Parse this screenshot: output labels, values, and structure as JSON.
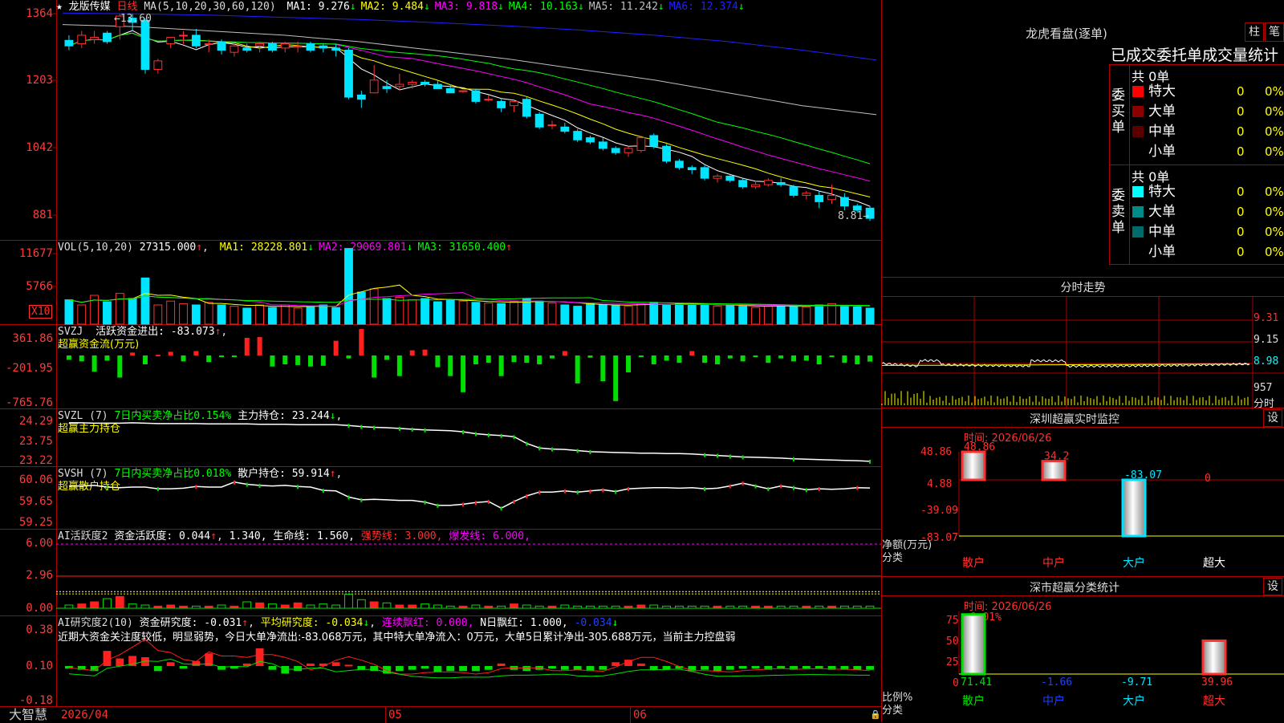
{
  "app": {
    "brand": "大智慧"
  },
  "main": {
    "stock_name": "龙版传媒",
    "period": "日线",
    "ma_params": "MA(5,10,20,30,60,120)",
    "ma": [
      {
        "label": "MA1:",
        "value": "9.276",
        "arrow": "↓",
        "color": "#ffffff"
      },
      {
        "label": "MA2:",
        "value": "9.484",
        "arrow": "↓",
        "color": "#ffff00"
      },
      {
        "label": "MA3:",
        "value": "9.818",
        "arrow": "↓",
        "color": "#ff00ff"
      },
      {
        "label": "MA4:",
        "value": "10.163",
        "arrow": "↓",
        "color": "#00ff00"
      },
      {
        "label": "MA5:",
        "value": "11.242",
        "arrow": "↓",
        "color": "#c0c0c0"
      },
      {
        "label": "MA6:",
        "value": "12.374",
        "arrow": "↓",
        "color": "#2020ff"
      }
    ],
    "y_labels": [
      "1364",
      "1203",
      "1042",
      "881"
    ],
    "high_marker": "←13.60",
    "low_marker": "8.81→",
    "candles": [
      [
        12.98,
        13.1,
        12.75,
        12.85
      ],
      [
        12.9,
        13.2,
        12.8,
        13.1
      ],
      [
        13.0,
        13.2,
        12.9,
        13.05
      ],
      [
        13.15,
        13.2,
        12.9,
        12.95
      ],
      [
        13.3,
        13.6,
        13.0,
        13.55
      ],
      [
        13.5,
        13.6,
        13.2,
        13.4
      ],
      [
        13.45,
        13.5,
        12.2,
        12.3
      ],
      [
        12.3,
        12.55,
        12.2,
        12.5
      ],
      [
        12.9,
        13.05,
        12.8,
        13.05
      ],
      [
        13.1,
        13.2,
        12.9,
        13.1
      ],
      [
        13.1,
        13.25,
        12.8,
        12.85
      ],
      [
        12.9,
        13.0,
        12.7,
        12.9
      ],
      [
        12.95,
        13.0,
        12.65,
        12.75
      ],
      [
        12.7,
        12.9,
        12.6,
        12.85
      ],
      [
        12.8,
        12.9,
        12.7,
        12.75
      ],
      [
        12.85,
        12.95,
        12.7,
        12.9
      ],
      [
        12.9,
        12.95,
        12.7,
        12.75
      ],
      [
        12.8,
        12.95,
        12.7,
        12.9
      ],
      [
        12.85,
        12.95,
        12.7,
        12.85
      ],
      [
        12.9,
        12.95,
        12.7,
        12.75
      ],
      [
        12.85,
        12.9,
        12.7,
        12.8
      ],
      [
        12.8,
        12.9,
        12.6,
        12.75
      ],
      [
        12.75,
        12.8,
        11.6,
        11.65
      ],
      [
        11.7,
        11.8,
        11.4,
        11.6
      ],
      [
        11.75,
        12.4,
        11.8,
        12.05
      ],
      [
        11.9,
        12.05,
        11.75,
        11.85
      ],
      [
        11.9,
        12.2,
        11.8,
        11.95
      ],
      [
        11.95,
        12.05,
        11.85,
        12.0
      ],
      [
        12.0,
        12.05,
        11.9,
        11.95
      ],
      [
        11.95,
        12.05,
        11.85,
        11.85
      ],
      [
        11.85,
        11.95,
        11.75,
        11.75
      ],
      [
        11.8,
        11.8,
        11.75,
        11.8
      ],
      [
        11.8,
        11.85,
        11.5,
        11.55
      ],
      [
        11.6,
        11.7,
        11.55,
        11.6
      ],
      [
        11.55,
        11.6,
        11.3,
        11.4
      ],
      [
        11.45,
        11.55,
        11.3,
        11.55
      ],
      [
        11.6,
        11.65,
        11.15,
        11.2
      ],
      [
        11.25,
        11.3,
        10.9,
        10.95
      ],
      [
        11.0,
        11.1,
        10.9,
        11.0
      ],
      [
        10.95,
        11.05,
        10.8,
        10.85
      ],
      [
        10.85,
        10.9,
        10.6,
        10.65
      ],
      [
        10.7,
        10.75,
        10.55,
        10.6
      ],
      [
        10.6,
        10.7,
        10.4,
        10.45
      ],
      [
        10.45,
        10.5,
        10.3,
        10.35
      ],
      [
        10.35,
        10.5,
        10.25,
        10.45
      ],
      [
        10.4,
        10.75,
        10.35,
        10.7
      ],
      [
        10.75,
        10.8,
        10.45,
        10.5
      ],
      [
        10.5,
        10.55,
        10.1,
        10.15
      ],
      [
        10.15,
        10.2,
        9.95,
        10.0
      ],
      [
        10.0,
        10.05,
        9.85,
        9.95
      ],
      [
        10.0,
        10.05,
        9.7,
        9.75
      ],
      [
        9.75,
        9.85,
        9.65,
        9.8
      ],
      [
        9.8,
        9.85,
        9.65,
        9.7
      ],
      [
        9.7,
        9.75,
        9.5,
        9.55
      ],
      [
        9.55,
        9.7,
        9.5,
        9.6
      ],
      [
        9.6,
        9.75,
        9.55,
        9.7
      ],
      [
        9.65,
        9.75,
        9.55,
        9.6
      ],
      [
        9.55,
        9.6,
        9.3,
        9.35
      ],
      [
        9.35,
        9.45,
        9.25,
        9.4
      ],
      [
        9.35,
        9.45,
        9.05,
        9.2
      ],
      [
        9.25,
        9.6,
        9.15,
        9.35
      ],
      [
        9.3,
        9.4,
        9.0,
        9.1
      ],
      [
        9.1,
        9.15,
        8.95,
        9.0
      ],
      [
        9.05,
        9.1,
        8.75,
        8.81
      ]
    ]
  },
  "vol": {
    "params": "VOL(5,10,20)",
    "value": "27315.000",
    "value_arrow": "↑",
    "ma": [
      {
        "label": "MA1:",
        "value": "28228.801",
        "arrow": "↓",
        "color": "#ffff00"
      },
      {
        "label": "MA2:",
        "value": "29069.801",
        "arrow": "↓",
        "color": "#ff00ff"
      },
      {
        "label": "MA3:",
        "value": "31650.400",
        "arrow": "↑",
        "color": "#00ff00"
      }
    ],
    "y_labels": [
      "11677",
      "5766"
    ],
    "unit": "X10",
    "bars": [
      38,
      30,
      45,
      35,
      48,
      40,
      72,
      30,
      36,
      32,
      30,
      34,
      30,
      28,
      25,
      30,
      26,
      30,
      25,
      28,
      30,
      26,
      118,
      50,
      55,
      40,
      42,
      38,
      40,
      35,
      38,
      36,
      34,
      33,
      32,
      35,
      40,
      36,
      33,
      30,
      28,
      32,
      30,
      30,
      28,
      32,
      34,
      30,
      32,
      30,
      30,
      28,
      30,
      28,
      26,
      28,
      30,
      28,
      27,
      30,
      32,
      28,
      27,
      25
    ]
  },
  "svzj": {
    "name": "SVZJ",
    "flow_label": "活跃资金进出:",
    "flow_value": "-83.073",
    "flow_arrow": "↑",
    "sub_label": "超赢资金流(万元)",
    "y_labels": [
      "361.86",
      "-201.95",
      "-765.76"
    ],
    "bars": [
      -60,
      -80,
      -220,
      -70,
      -300,
      40,
      -120,
      10,
      50,
      -80,
      60,
      -90,
      -10,
      -20,
      240,
      250,
      -150,
      -120,
      -130,
      -150,
      -140,
      200,
      -40,
      360,
      -300,
      -60,
      -280,
      70,
      80,
      -160,
      -280,
      -500,
      -120,
      -100,
      -280,
      -90,
      -100,
      -120,
      -40,
      60,
      -380,
      -30,
      -350,
      -620,
      -230,
      -20,
      -120,
      -70,
      -100,
      60,
      -100,
      -120,
      -40,
      -80,
      -20,
      -100,
      -40,
      -80,
      -70,
      -120,
      -20,
      -100,
      -120,
      -83
    ]
  },
  "svzl": {
    "name": "SVZL",
    "period": "(7)",
    "ratio_label": "7日内买卖净占比0.154%",
    "hold_label": "主力持仓:",
    "hold_value": "23.244",
    "hold_arrow": "↓",
    "sub_label": "超赢主力持仓",
    "y_labels": [
      "24.29",
      "23.75",
      "23.22"
    ],
    "line": [
      24.27,
      24.27,
      24.26,
      24.26,
      24.26,
      24.27,
      24.26,
      24.25,
      24.25,
      24.25,
      24.25,
      24.24,
      24.24,
      24.24,
      24.24,
      24.23,
      24.23,
      24.23,
      24.22,
      24.22,
      24.22,
      24.22,
      24.2,
      24.17,
      24.15,
      24.14,
      24.12,
      24.1,
      24.08,
      24.07,
      24.06,
      24.03,
      23.98,
      23.95,
      23.93,
      23.9,
      23.72,
      23.6,
      23.57,
      23.56,
      23.53,
      23.5,
      23.49,
      23.48,
      23.47,
      23.46,
      23.46,
      23.45,
      23.45,
      23.44,
      23.42,
      23.4,
      23.38,
      23.36,
      23.35,
      23.34,
      23.33,
      23.31,
      23.3,
      23.29,
      23.28,
      23.27,
      23.26,
      23.244
    ]
  },
  "svsh": {
    "name": "SVSH",
    "period": "(7)",
    "ratio_label": "7日内买卖净占比0.018%",
    "hold_label": "散户持仓:",
    "hold_value": "59.914",
    "hold_arrow": "↑",
    "sub_label": "超赢散户持仓",
    "y_labels": [
      "60.06",
      "59.65",
      "59.25"
    ],
    "line": [
      59.95,
      59.95,
      59.96,
      59.93,
      59.92,
      59.93,
      59.93,
      59.9,
      59.9,
      59.91,
      59.94,
      59.93,
      59.93,
      60.02,
      59.98,
      59.96,
      59.95,
      59.96,
      59.94,
      59.93,
      59.87,
      59.86,
      59.75,
      59.7,
      59.71,
      59.7,
      59.69,
      59.69,
      59.66,
      59.6,
      59.6,
      59.62,
      59.65,
      59.67,
      59.55,
      59.67,
      59.77,
      59.84,
      59.84,
      59.86,
      59.84,
      59.86,
      59.88,
      59.85,
      59.9,
      59.91,
      59.92,
      59.92,
      59.91,
      59.92,
      59.9,
      59.91,
      59.95,
      60.0,
      59.95,
      59.9,
      59.95,
      59.92,
      59.88,
      59.9,
      59.89,
      59.9,
      59.92,
      59.914
    ]
  },
  "ai1": {
    "title": "AI活跃度2",
    "act_label": "资金活跃度:",
    "act_value": "0.044",
    "act_value2": "1.340,",
    "life_label": "生命线:",
    "life_value": "1.560,",
    "strong_label": "强势线:",
    "strong_value": "3.000,",
    "burst_label": "爆发线:",
    "burst_value": "6.000,",
    "y_labels": [
      "6.00",
      "2.96",
      "0.00"
    ],
    "bars": [
      0.3,
      0.4,
      0.6,
      0.9,
      1.1,
      0.4,
      0.3,
      0.2,
      0.3,
      0.2,
      0.2,
      0.2,
      0.3,
      0.2,
      0.6,
      0.5,
      0.4,
      0.3,
      0.5,
      0.3,
      0.4,
      0.3,
      1.3,
      0.8,
      0.6,
      0.5,
      0.3,
      0.3,
      0.4,
      0.3,
      0.2,
      0.2,
      0.3,
      0.2,
      0.2,
      0.4,
      0.3,
      0.2,
      0.2,
      0.3,
      0.2,
      0.2,
      0.2,
      0.2,
      0.2,
      0.3,
      0.3,
      0.2,
      0.2,
      0.2,
      0.2,
      0.2,
      0.2,
      0.2,
      0.2,
      0.2,
      0.2,
      0.2,
      0.2,
      0.2,
      0.2,
      0.2,
      0.2,
      0.2
    ]
  },
  "ai2": {
    "title": "AI研究度2(10)",
    "res_label": "资金研究度:",
    "res_value": "-0.031",
    "avg_label": "平均研究度:",
    "avg_value": "-0.034",
    "red_label": "连续飘红:",
    "red_value": "0.000,",
    "nred_label": "N日飘红:",
    "nred_value": "1.000,",
    "last_value": "-0.034",
    "comment": "近期大资金关注度较低，明显弱势，今日大单净流出:-83.068万元，其中特大单净流入：0万元，大单5日累计净出-305.688万元，当前主力控盘弱",
    "y_labels": [
      "0.38",
      "0.10",
      "-0.18"
    ],
    "bars": [
      -0.02,
      -0.03,
      -0.04,
      0.12,
      0.06,
      0.08,
      0.07,
      -0.04,
      0.03,
      -0.02,
      0.04,
      0.1,
      -0.03,
      -0.02,
      0.02,
      0.14,
      -0.03,
      -0.06,
      -0.04,
      0.02,
      0.02,
      0.03,
      0.01,
      -0.03,
      -0.04,
      -0.06,
      -0.04,
      -0.03,
      -0.02,
      -0.05,
      -0.04,
      -0.04,
      -0.04,
      -0.03,
      0.02,
      -0.03,
      -0.04,
      -0.03,
      -0.02,
      -0.03,
      -0.03,
      -0.04,
      -0.03,
      0.03,
      0.05,
      0.02,
      -0.03,
      -0.03,
      -0.02,
      -0.04,
      -0.03,
      -0.04,
      -0.03,
      -0.02,
      -0.02,
      -0.03,
      -0.02,
      -0.03,
      -0.02,
      -0.02,
      -0.03,
      -0.03,
      -0.03,
      -0.03
    ]
  },
  "xaxis": {
    "labels": [
      "2026/04",
      "05",
      "06"
    ]
  },
  "longhu": {
    "title": "龙虎看盘(逐单)",
    "btn1": "柱",
    "btn2": "笔",
    "subtitle": "已成交委托单成交量统计",
    "buy_side": "委买单",
    "sell_side": "委卖单",
    "buy_total": "共 0单",
    "sell_total": "共 0单",
    "buy_rows": [
      {
        "label": "特大",
        "count": "0",
        "pct": "0%",
        "color": "#ff0000"
      },
      {
        "label": "大单",
        "count": "0",
        "pct": "0%",
        "color": "#8b0000"
      },
      {
        "label": "中单",
        "count": "0",
        "pct": "0%",
        "color": "#5a0000"
      },
      {
        "label": "小单",
        "count": "0",
        "pct": "0%",
        "color": "#000000"
      }
    ],
    "sell_rows": [
      {
        "label": "特大",
        "count": "0",
        "pct": "0%",
        "color": "#00ffff"
      },
      {
        "label": "大单",
        "count": "0",
        "pct": "0%",
        "color": "#008b8b"
      },
      {
        "label": "中单",
        "count": "0",
        "pct": "0%",
        "color": "#006b6b"
      },
      {
        "label": "小单",
        "count": "0",
        "pct": "0%",
        "color": "#000000"
      }
    ]
  },
  "intraday": {
    "title": "分时走势",
    "y_labels": [
      "9.31",
      "9.15",
      "8.98",
      "957"
    ],
    "vol_label": "分时"
  },
  "sz_monitor": {
    "title": "深圳超赢实时监控",
    "btn": "设",
    "date": "时间: 2026/06/26",
    "y_labels": [
      "48.86",
      "4.88",
      "-39.09",
      "-83.07"
    ],
    "y_title": "净额(万元)",
    "cat_title": "分类",
    "bar_values": [
      "48.86",
      "34.2",
      "-83.07",
      "0"
    ],
    "categories": [
      "散户",
      "中户",
      "大户",
      "超大"
    ],
    "chart_data": {
      "type": "bar",
      "categories": [
        "散户",
        "中户",
        "大户",
        "超大"
      ],
      "values": [
        48.86,
        34.2,
        -83.07,
        0
      ],
      "ylim": [
        -83.07,
        48.86
      ]
    }
  },
  "sz_class": {
    "title": "深市超赢分类统计",
    "btn": "设",
    "date": "时间: 2026/06/26",
    "top_label": "+0.01%",
    "y_labels": [
      "75",
      "50",
      "25",
      "0"
    ],
    "y_title": "比例%",
    "cat_title": "分类",
    "bar_values": [
      "71.41",
      "-1.66",
      "-9.71",
      "39.96"
    ],
    "categories": [
      "散户",
      "中户",
      "大户",
      "超大"
    ],
    "chart_data": {
      "type": "bar",
      "categories": [
        "散户",
        "中户",
        "大户",
        "超大"
      ],
      "values": [
        71.41,
        -1.66,
        -9.71,
        39.96
      ],
      "ylim": [
        0,
        75
      ]
    }
  }
}
